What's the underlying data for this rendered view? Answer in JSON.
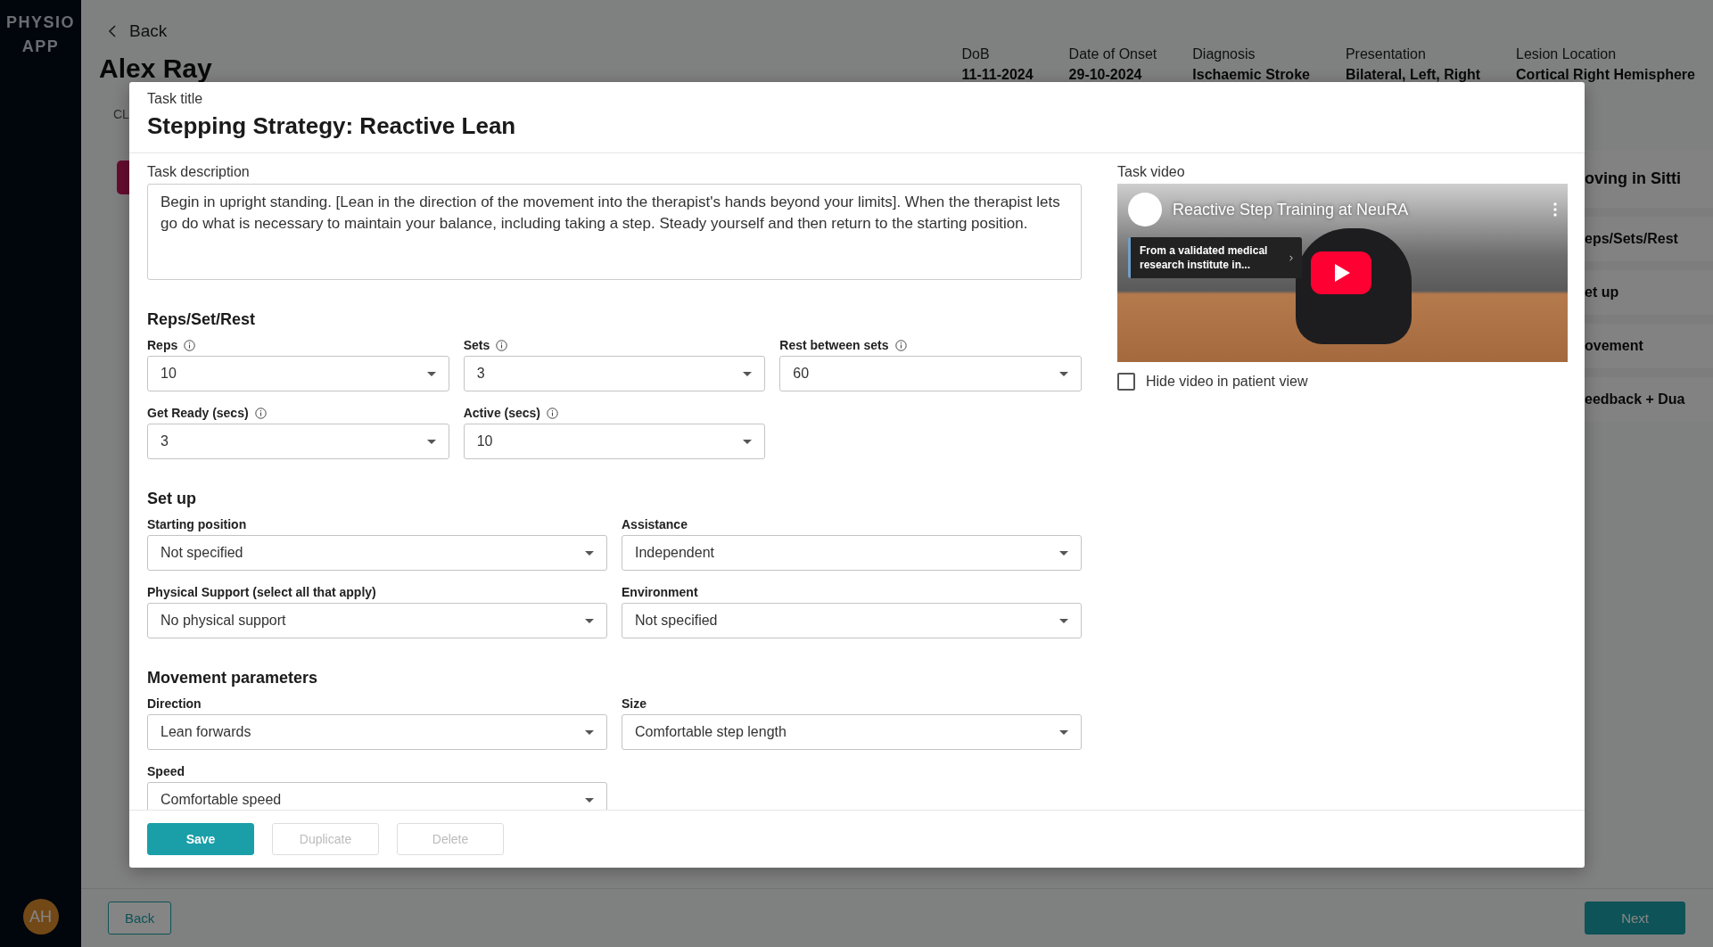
{
  "sidebar": {
    "logo": [
      "PHYSIO",
      "APP"
    ],
    "avatar": "AH"
  },
  "page": {
    "back": "Back",
    "patient_name": "Alex Ray",
    "tab": "CL",
    "patient_info": [
      {
        "label": "DoB",
        "value": "11-11-2024"
      },
      {
        "label": "Date of Onset",
        "value": "29-10-2024"
      },
      {
        "label": "Diagnosis",
        "value": "Ischaemic Stroke"
      },
      {
        "label": "Presentation",
        "value": "Bilateral, Left, Right"
      },
      {
        "label": "Lesion Location",
        "value": "Cortical Right Hemisphere"
      }
    ],
    "side_panel": {
      "title": "oving in Sitti",
      "items": [
        "eps/Sets/Rest",
        "et up",
        "ovement",
        "eedback + Dua"
      ]
    },
    "footer": {
      "back": "Back",
      "next": "Next"
    }
  },
  "modal": {
    "title_label": "Task title",
    "title": "Stepping Strategy: Reactive Lean",
    "description_label": "Task description",
    "description": "Begin in upright standing. [Lean in the direction of the movement into the therapist's hands beyond your limits]. When the therapist lets go do what is necessary to maintain your balance, including taking a step. Steady yourself and then return to the starting position.",
    "sections": [
      {
        "kind": "timing",
        "heading": "Reps/Set/Rest",
        "fields": [
          {
            "label": "Reps",
            "info": true,
            "value": "10"
          },
          {
            "label": "Sets",
            "info": true,
            "value": "3"
          },
          {
            "label": "Rest between sets",
            "info": true,
            "value": "60"
          },
          {
            "label": "Get Ready (secs)",
            "info": true,
            "value": "3"
          },
          {
            "label": "Active (secs)",
            "info": true,
            "value": "10"
          }
        ]
      },
      {
        "kind": "choice",
        "heading": "Set up",
        "fields": [
          {
            "label": "Starting position",
            "info": false,
            "value": "Not specified"
          },
          {
            "label": "Assistance",
            "info": false,
            "value": "Independent"
          },
          {
            "label": "Physical Support (select all that apply)",
            "info": false,
            "value": "No physical support"
          },
          {
            "label": "Environment",
            "info": false,
            "value": "Not specified"
          }
        ]
      },
      {
        "kind": "choice",
        "heading": "Movement parameters",
        "fields": [
          {
            "label": "Direction",
            "info": false,
            "value": "Lean forwards"
          },
          {
            "label": "Size",
            "info": false,
            "value": "Comfortable step length"
          },
          {
            "label": "Speed",
            "info": false,
            "value": "Comfortable speed"
          }
        ]
      }
    ],
    "video": {
      "label": "Task video",
      "title": "Reactive Step Training at NeuRA",
      "card": "From a validated medical research institute in..."
    },
    "hide_video": {
      "label": "Hide video in patient view",
      "checked": false
    },
    "buttons": [
      {
        "label": "Save",
        "disabled": false
      },
      {
        "label": "Duplicate",
        "disabled": true
      },
      {
        "label": "Delete",
        "disabled": true
      }
    ]
  }
}
